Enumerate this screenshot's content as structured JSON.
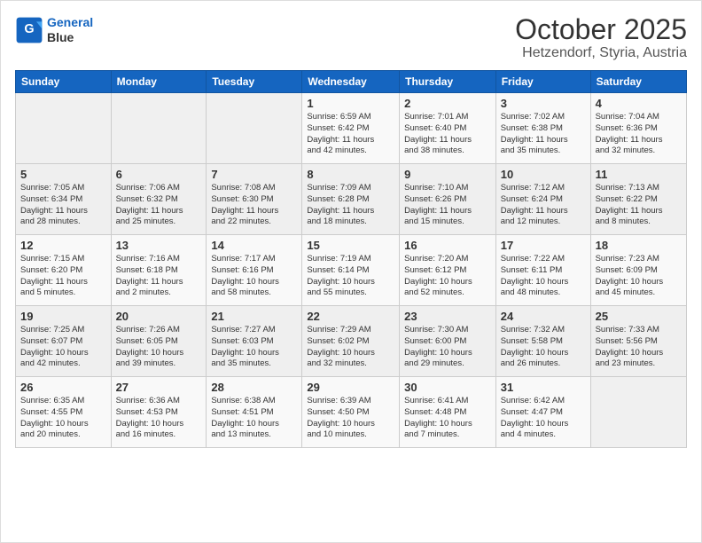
{
  "header": {
    "logo_line1": "General",
    "logo_line2": "Blue",
    "month": "October 2025",
    "location": "Hetzendorf, Styria, Austria"
  },
  "weekdays": [
    "Sunday",
    "Monday",
    "Tuesday",
    "Wednesday",
    "Thursday",
    "Friday",
    "Saturday"
  ],
  "weeks": [
    [
      {
        "day": "",
        "info": ""
      },
      {
        "day": "",
        "info": ""
      },
      {
        "day": "",
        "info": ""
      },
      {
        "day": "1",
        "info": "Sunrise: 6:59 AM\nSunset: 6:42 PM\nDaylight: 11 hours\nand 42 minutes."
      },
      {
        "day": "2",
        "info": "Sunrise: 7:01 AM\nSunset: 6:40 PM\nDaylight: 11 hours\nand 38 minutes."
      },
      {
        "day": "3",
        "info": "Sunrise: 7:02 AM\nSunset: 6:38 PM\nDaylight: 11 hours\nand 35 minutes."
      },
      {
        "day": "4",
        "info": "Sunrise: 7:04 AM\nSunset: 6:36 PM\nDaylight: 11 hours\nand 32 minutes."
      }
    ],
    [
      {
        "day": "5",
        "info": "Sunrise: 7:05 AM\nSunset: 6:34 PM\nDaylight: 11 hours\nand 28 minutes."
      },
      {
        "day": "6",
        "info": "Sunrise: 7:06 AM\nSunset: 6:32 PM\nDaylight: 11 hours\nand 25 minutes."
      },
      {
        "day": "7",
        "info": "Sunrise: 7:08 AM\nSunset: 6:30 PM\nDaylight: 11 hours\nand 22 minutes."
      },
      {
        "day": "8",
        "info": "Sunrise: 7:09 AM\nSunset: 6:28 PM\nDaylight: 11 hours\nand 18 minutes."
      },
      {
        "day": "9",
        "info": "Sunrise: 7:10 AM\nSunset: 6:26 PM\nDaylight: 11 hours\nand 15 minutes."
      },
      {
        "day": "10",
        "info": "Sunrise: 7:12 AM\nSunset: 6:24 PM\nDaylight: 11 hours\nand 12 minutes."
      },
      {
        "day": "11",
        "info": "Sunrise: 7:13 AM\nSunset: 6:22 PM\nDaylight: 11 hours\nand 8 minutes."
      }
    ],
    [
      {
        "day": "12",
        "info": "Sunrise: 7:15 AM\nSunset: 6:20 PM\nDaylight: 11 hours\nand 5 minutes."
      },
      {
        "day": "13",
        "info": "Sunrise: 7:16 AM\nSunset: 6:18 PM\nDaylight: 11 hours\nand 2 minutes."
      },
      {
        "day": "14",
        "info": "Sunrise: 7:17 AM\nSunset: 6:16 PM\nDaylight: 10 hours\nand 58 minutes."
      },
      {
        "day": "15",
        "info": "Sunrise: 7:19 AM\nSunset: 6:14 PM\nDaylight: 10 hours\nand 55 minutes."
      },
      {
        "day": "16",
        "info": "Sunrise: 7:20 AM\nSunset: 6:12 PM\nDaylight: 10 hours\nand 52 minutes."
      },
      {
        "day": "17",
        "info": "Sunrise: 7:22 AM\nSunset: 6:11 PM\nDaylight: 10 hours\nand 48 minutes."
      },
      {
        "day": "18",
        "info": "Sunrise: 7:23 AM\nSunset: 6:09 PM\nDaylight: 10 hours\nand 45 minutes."
      }
    ],
    [
      {
        "day": "19",
        "info": "Sunrise: 7:25 AM\nSunset: 6:07 PM\nDaylight: 10 hours\nand 42 minutes."
      },
      {
        "day": "20",
        "info": "Sunrise: 7:26 AM\nSunset: 6:05 PM\nDaylight: 10 hours\nand 39 minutes."
      },
      {
        "day": "21",
        "info": "Sunrise: 7:27 AM\nSunset: 6:03 PM\nDaylight: 10 hours\nand 35 minutes."
      },
      {
        "day": "22",
        "info": "Sunrise: 7:29 AM\nSunset: 6:02 PM\nDaylight: 10 hours\nand 32 minutes."
      },
      {
        "day": "23",
        "info": "Sunrise: 7:30 AM\nSunset: 6:00 PM\nDaylight: 10 hours\nand 29 minutes."
      },
      {
        "day": "24",
        "info": "Sunrise: 7:32 AM\nSunset: 5:58 PM\nDaylight: 10 hours\nand 26 minutes."
      },
      {
        "day": "25",
        "info": "Sunrise: 7:33 AM\nSunset: 5:56 PM\nDaylight: 10 hours\nand 23 minutes."
      }
    ],
    [
      {
        "day": "26",
        "info": "Sunrise: 6:35 AM\nSunset: 4:55 PM\nDaylight: 10 hours\nand 20 minutes."
      },
      {
        "day": "27",
        "info": "Sunrise: 6:36 AM\nSunset: 4:53 PM\nDaylight: 10 hours\nand 16 minutes."
      },
      {
        "day": "28",
        "info": "Sunrise: 6:38 AM\nSunset: 4:51 PM\nDaylight: 10 hours\nand 13 minutes."
      },
      {
        "day": "29",
        "info": "Sunrise: 6:39 AM\nSunset: 4:50 PM\nDaylight: 10 hours\nand 10 minutes."
      },
      {
        "day": "30",
        "info": "Sunrise: 6:41 AM\nSunset: 4:48 PM\nDaylight: 10 hours\nand 7 minutes."
      },
      {
        "day": "31",
        "info": "Sunrise: 6:42 AM\nSunset: 4:47 PM\nDaylight: 10 hours\nand 4 minutes."
      },
      {
        "day": "",
        "info": ""
      }
    ]
  ]
}
